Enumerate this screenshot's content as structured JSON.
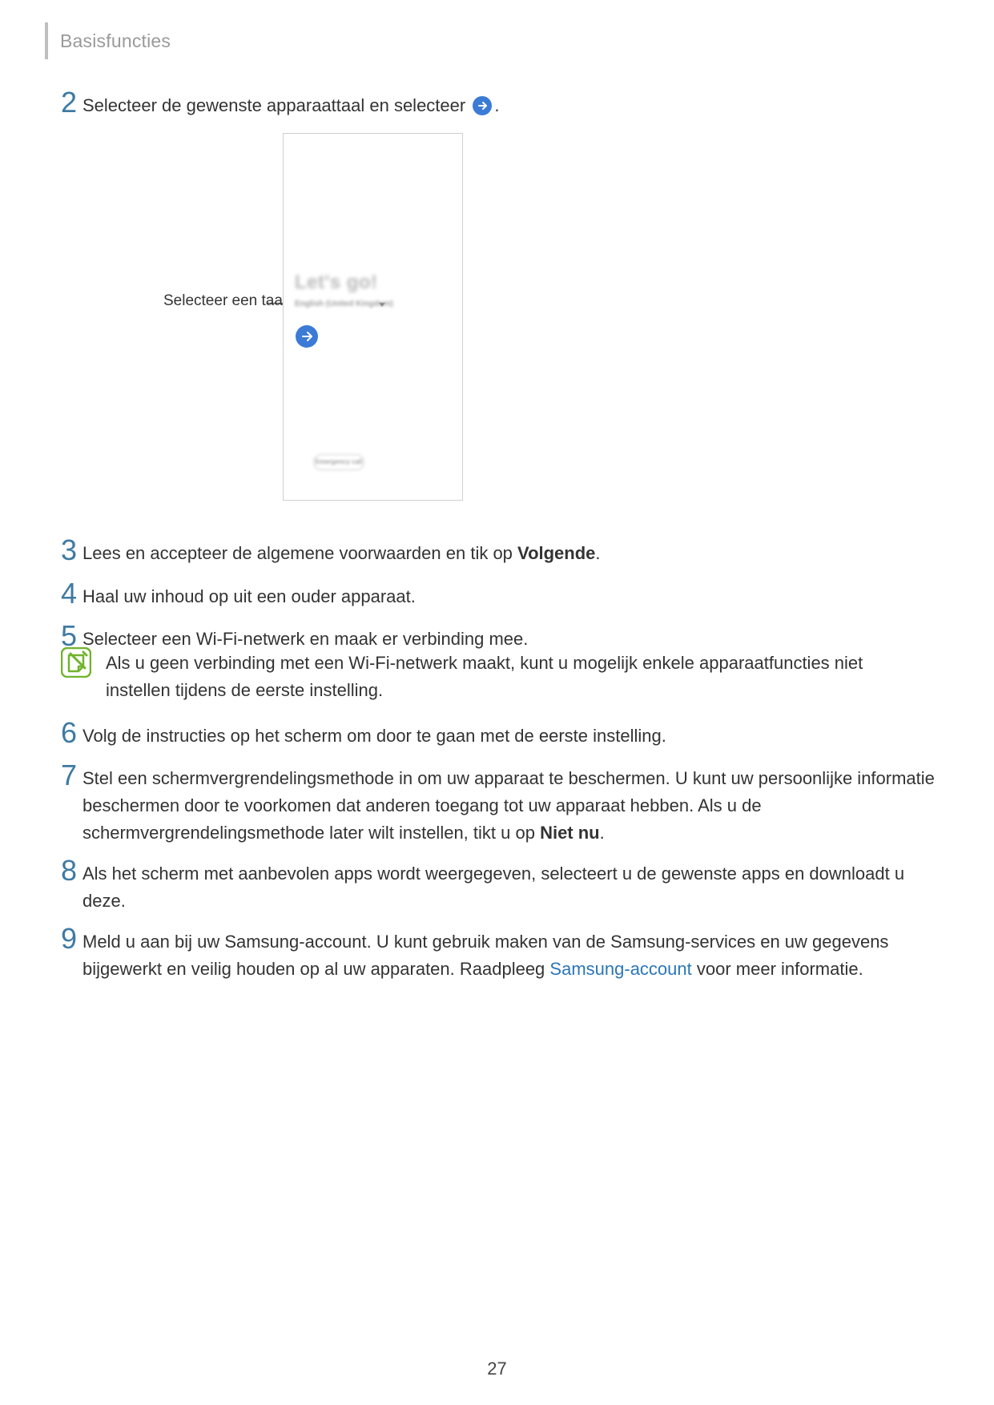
{
  "header": {
    "section": "Basisfuncties"
  },
  "page_number": "27",
  "step2": {
    "num": "2",
    "text_before": "Selecteer de gewenste apparaattaal en selecteer",
    "text_after": "."
  },
  "callout": {
    "label": "Selecteer een taal."
  },
  "phone": {
    "heading": "Let's go!",
    "lang": "English (United Kingdom)",
    "emergency": "Emergency call"
  },
  "step3": {
    "num": "3",
    "part1": "Lees en accepteer de algemene voorwaarden en tik op ",
    "bold": "Volgende",
    "part2": "."
  },
  "step4": {
    "num": "4",
    "text": "Haal uw inhoud op uit een ouder apparaat."
  },
  "step5": {
    "num": "5",
    "text": "Selecteer een Wi-Fi-netwerk en maak er verbinding mee."
  },
  "note": {
    "text": "Als u geen verbinding met een Wi-Fi-netwerk maakt, kunt u mogelijk enkele apparaatfuncties niet instellen tijdens de eerste instelling."
  },
  "step6": {
    "num": "6",
    "text": "Volg de instructies op het scherm om door te gaan met de eerste instelling."
  },
  "step7": {
    "num": "7",
    "part1": "Stel een schermvergrendelingsmethode in om uw apparaat te beschermen. U kunt uw persoonlijke informatie beschermen door te voorkomen dat anderen toegang tot uw apparaat hebben. Als u de schermvergrendelingsmethode later wilt instellen, tikt u op ",
    "bold": "Niet nu",
    "part2": "."
  },
  "step8": {
    "num": "8",
    "text": "Als het scherm met aanbevolen apps wordt weergegeven, selecteert u de gewenste apps en downloadt u deze."
  },
  "step9": {
    "num": "9",
    "part1": "Meld u aan bij uw Samsung-account. U kunt gebruik maken van de Samsung-services en uw gegevens bijgewerkt en veilig houden op al uw apparaten. Raadpleeg ",
    "link": "Samsung-account",
    "part2": " voor meer informatie."
  }
}
